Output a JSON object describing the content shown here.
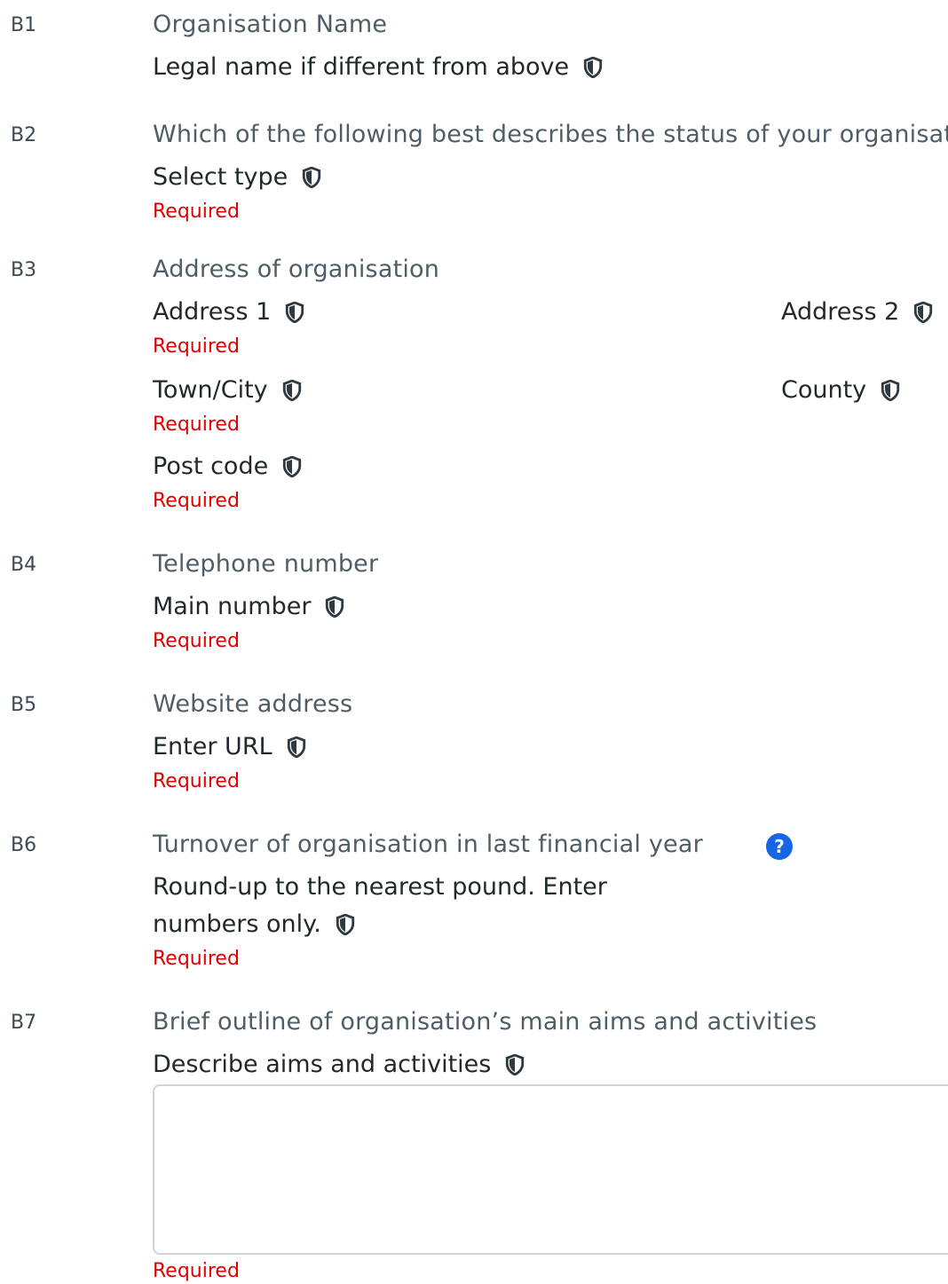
{
  "rows": {
    "b1": {
      "num": "B1",
      "question": "Organisation Name",
      "field": "Legal name if different from above"
    },
    "b2": {
      "num": "B2",
      "question": "Which of the following best describes the status of your organisation",
      "field": "Select type",
      "required": "Required"
    },
    "b3": {
      "num": "B3",
      "question": "Address of organisation",
      "address1": "Address 1",
      "address2": "Address 2",
      "town": "Town/City",
      "county": "County",
      "postcode": "Post code",
      "required": "Required"
    },
    "b4": {
      "num": "B4",
      "question": "Telephone number",
      "field": "Main number",
      "required": "Required"
    },
    "b5": {
      "num": "B5",
      "question": "Website address",
      "field": "Enter URL",
      "required": "Required"
    },
    "b6": {
      "num": "B6",
      "question": "Turnover of organisation in last financial year",
      "help": "?",
      "field_line1": "Round-up to the nearest pound. Enter",
      "field_line2": "numbers only.",
      "required": "Required"
    },
    "b7": {
      "num": "B7",
      "question": "Brief outline of organisation’s main aims and activities",
      "field": "Describe aims and activities",
      "value": "",
      "required": "Required"
    }
  },
  "icons": {
    "field_info": "shield-icon",
    "help": "question-circle-icon"
  },
  "colors": {
    "required": "#e00000",
    "help": "#1565e6"
  }
}
